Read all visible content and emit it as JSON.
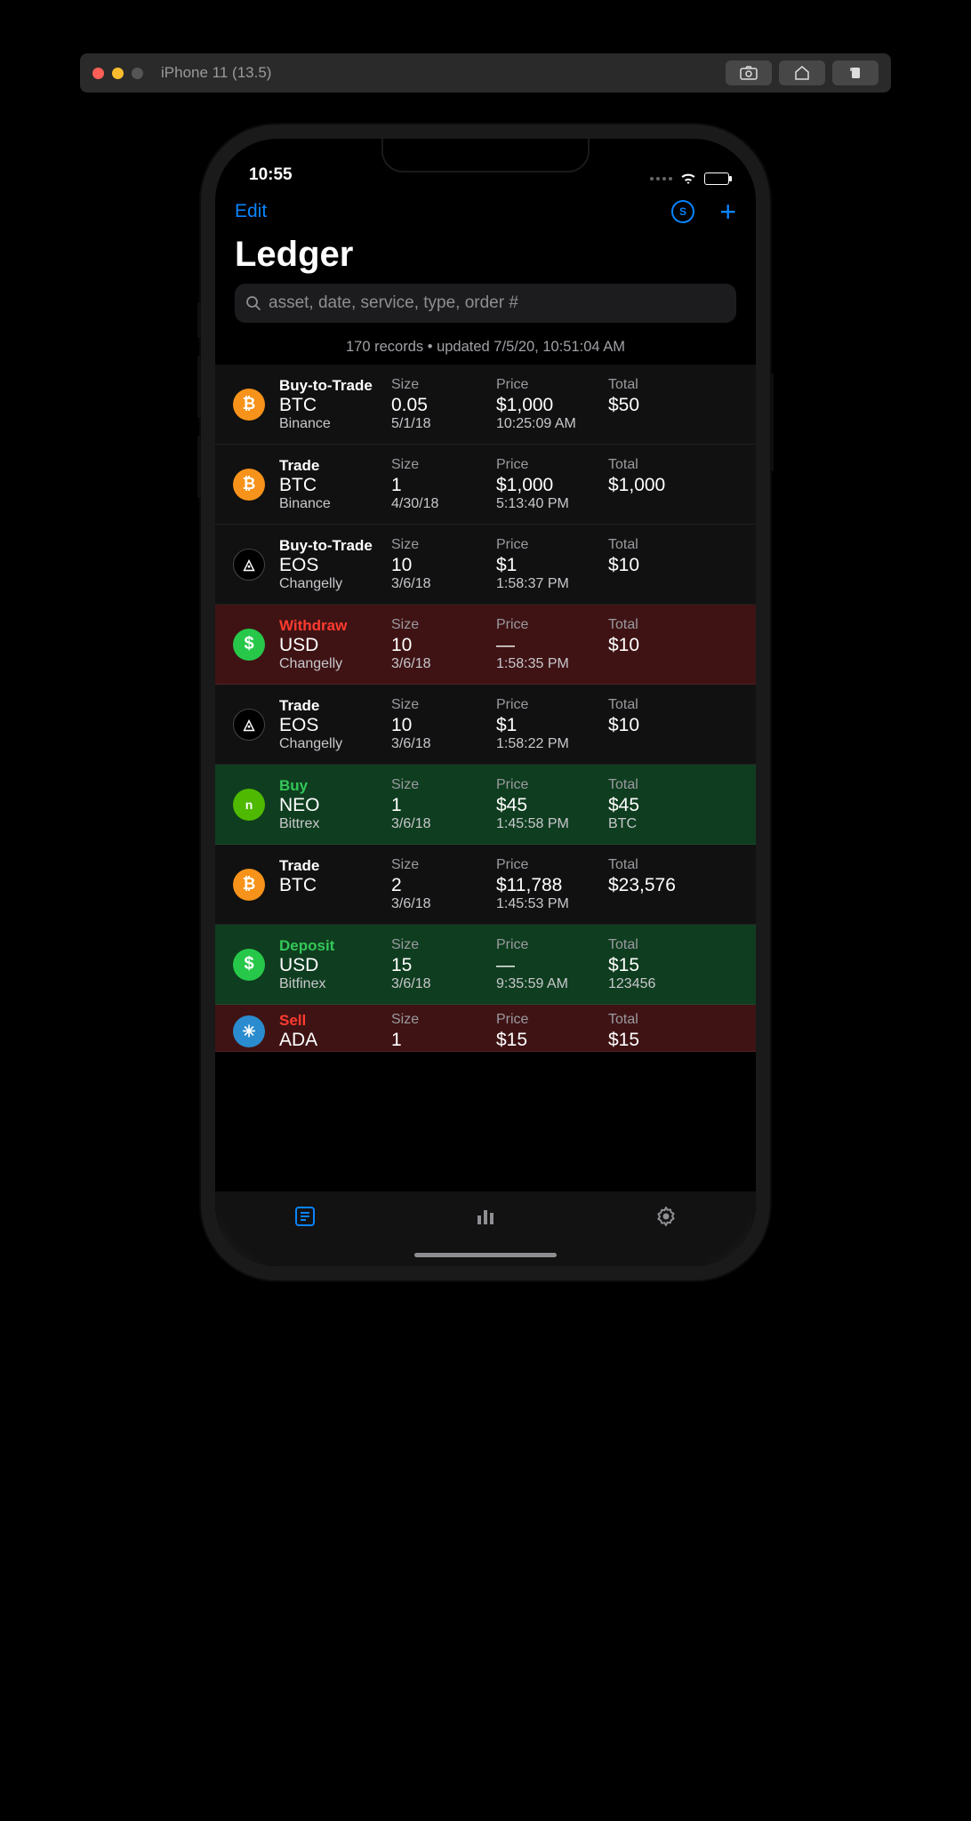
{
  "simulator": {
    "title": "iPhone 11 (13.5)"
  },
  "status": {
    "time": "10:55"
  },
  "nav": {
    "edit": "Edit"
  },
  "page_title": "Ledger",
  "search": {
    "placeholder": "asset, date, service, type, order #"
  },
  "meta": "170 records • updated 7/5/20, 10:51:04 AM",
  "labels": {
    "size": "Size",
    "price": "Price",
    "total": "Total"
  },
  "rows": [
    {
      "bg": "dark",
      "coin_class": "btc",
      "coin_glyph": "₿",
      "type_label": "Buy-to-Trade",
      "type_class": "default",
      "asset": "BTC",
      "service": "Binance",
      "size": "0.05",
      "date": "5/1/18",
      "price": "$1,000",
      "time": "10:25:09 AM",
      "total": "$50",
      "extra": ""
    },
    {
      "bg": "dark",
      "coin_class": "btc",
      "coin_glyph": "₿",
      "type_label": "Trade",
      "type_class": "default",
      "asset": "BTC",
      "service": "Binance",
      "size": "1",
      "date": "4/30/18",
      "price": "$1,000",
      "time": "5:13:40 PM",
      "total": "$1,000",
      "extra": ""
    },
    {
      "bg": "dark",
      "coin_class": "eos",
      "coin_glyph": "◬",
      "type_label": "Buy-to-Trade",
      "type_class": "default",
      "asset": "EOS",
      "service": "Changelly",
      "size": "10",
      "date": "3/6/18",
      "price": "$1",
      "time": "1:58:37 PM",
      "total": "$10",
      "extra": ""
    },
    {
      "bg": "red",
      "coin_class": "usd",
      "coin_glyph": "$",
      "type_label": "Withdraw",
      "type_class": "withdraw",
      "asset": "USD",
      "service": "Changelly",
      "size": "10",
      "date": "3/6/18",
      "price": "—",
      "time": "1:58:35 PM",
      "total": "$10",
      "extra": ""
    },
    {
      "bg": "dark",
      "coin_class": "eos",
      "coin_glyph": "◬",
      "type_label": "Trade",
      "type_class": "default",
      "asset": "EOS",
      "service": "Changelly",
      "size": "10",
      "date": "3/6/18",
      "price": "$1",
      "time": "1:58:22 PM",
      "total": "$10",
      "extra": ""
    },
    {
      "bg": "green",
      "coin_class": "neo",
      "coin_glyph": "n",
      "type_label": "Buy",
      "type_class": "buy",
      "asset": "NEO",
      "service": "Bittrex",
      "size": "1",
      "date": "3/6/18",
      "price": "$45",
      "time": "1:45:58 PM",
      "total": "$45",
      "extra": "BTC"
    },
    {
      "bg": "dark",
      "coin_class": "btc",
      "coin_glyph": "₿",
      "type_label": "Trade",
      "type_class": "default",
      "asset": "BTC",
      "service": "",
      "size": "2",
      "date": "3/6/18",
      "price": "$11,788",
      "time": "1:45:53 PM",
      "total": "$23,576",
      "extra": ""
    },
    {
      "bg": "green",
      "coin_class": "usd",
      "coin_glyph": "$",
      "type_label": "Deposit",
      "type_class": "deposit",
      "asset": "USD",
      "service": "Bitfinex",
      "size": "15",
      "date": "3/6/18",
      "price": "—",
      "time": "9:35:59 AM",
      "total": "$15",
      "extra": "123456"
    },
    {
      "bg": "redcut",
      "coin_class": "ada",
      "coin_glyph": "✳",
      "type_label": "Sell",
      "type_class": "sell",
      "asset": "ADA",
      "service": "",
      "size": "1",
      "date": "",
      "price": "$15",
      "time": "",
      "total": "$15",
      "extra": ""
    }
  ]
}
